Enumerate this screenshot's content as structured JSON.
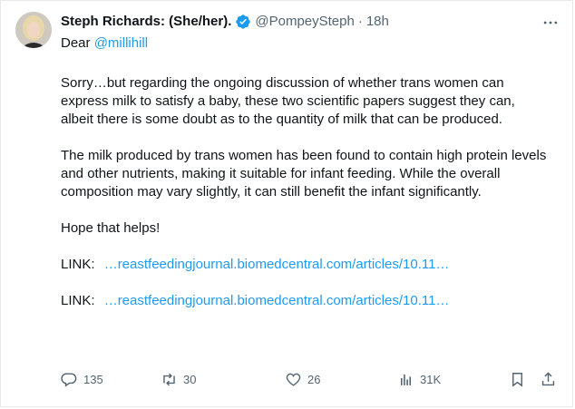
{
  "author": {
    "display_name": "Steph Richards: (She/her).",
    "handle": "@PompeySteph",
    "separator": "·",
    "time": "18h"
  },
  "reply": {
    "prefix": "Dear",
    "mention": "@millihill"
  },
  "body": {
    "paragraph_1": "Sorry…but regarding the ongoing discussion of whether trans women can express milk to satisfy a baby, these two scientific papers suggest they can, albeit there is some doubt as to the quantity of milk that can be produced.",
    "paragraph_2": "The milk produced by trans women has been found to contain high protein levels and other nutrients, making it suitable for infant feeding. While the overall composition may vary slightly, it can still benefit the infant significantly.",
    "paragraph_3": "Hope that helps!",
    "links": [
      {
        "label": "LINK:",
        "url": "…reastfeedingjournal.biomedcentral.com/articles/10.11…"
      },
      {
        "label": "LINK:",
        "url": "…reastfeedingjournal.biomedcentral.com/articles/10.11…"
      }
    ]
  },
  "actions": {
    "replies": "135",
    "reposts": "30",
    "likes": "26",
    "views": "31K"
  },
  "colors": {
    "link": "#1d9bf0",
    "verified": "#1d9bf0",
    "muted": "#536471",
    "text": "#0f1419"
  },
  "icons": {
    "verified": "verified-badge-icon",
    "more": "more-icon",
    "reply": "reply-icon",
    "repost": "repost-icon",
    "like": "like-icon",
    "views": "views-icon",
    "bookmark": "bookmark-icon",
    "share": "share-icon"
  }
}
